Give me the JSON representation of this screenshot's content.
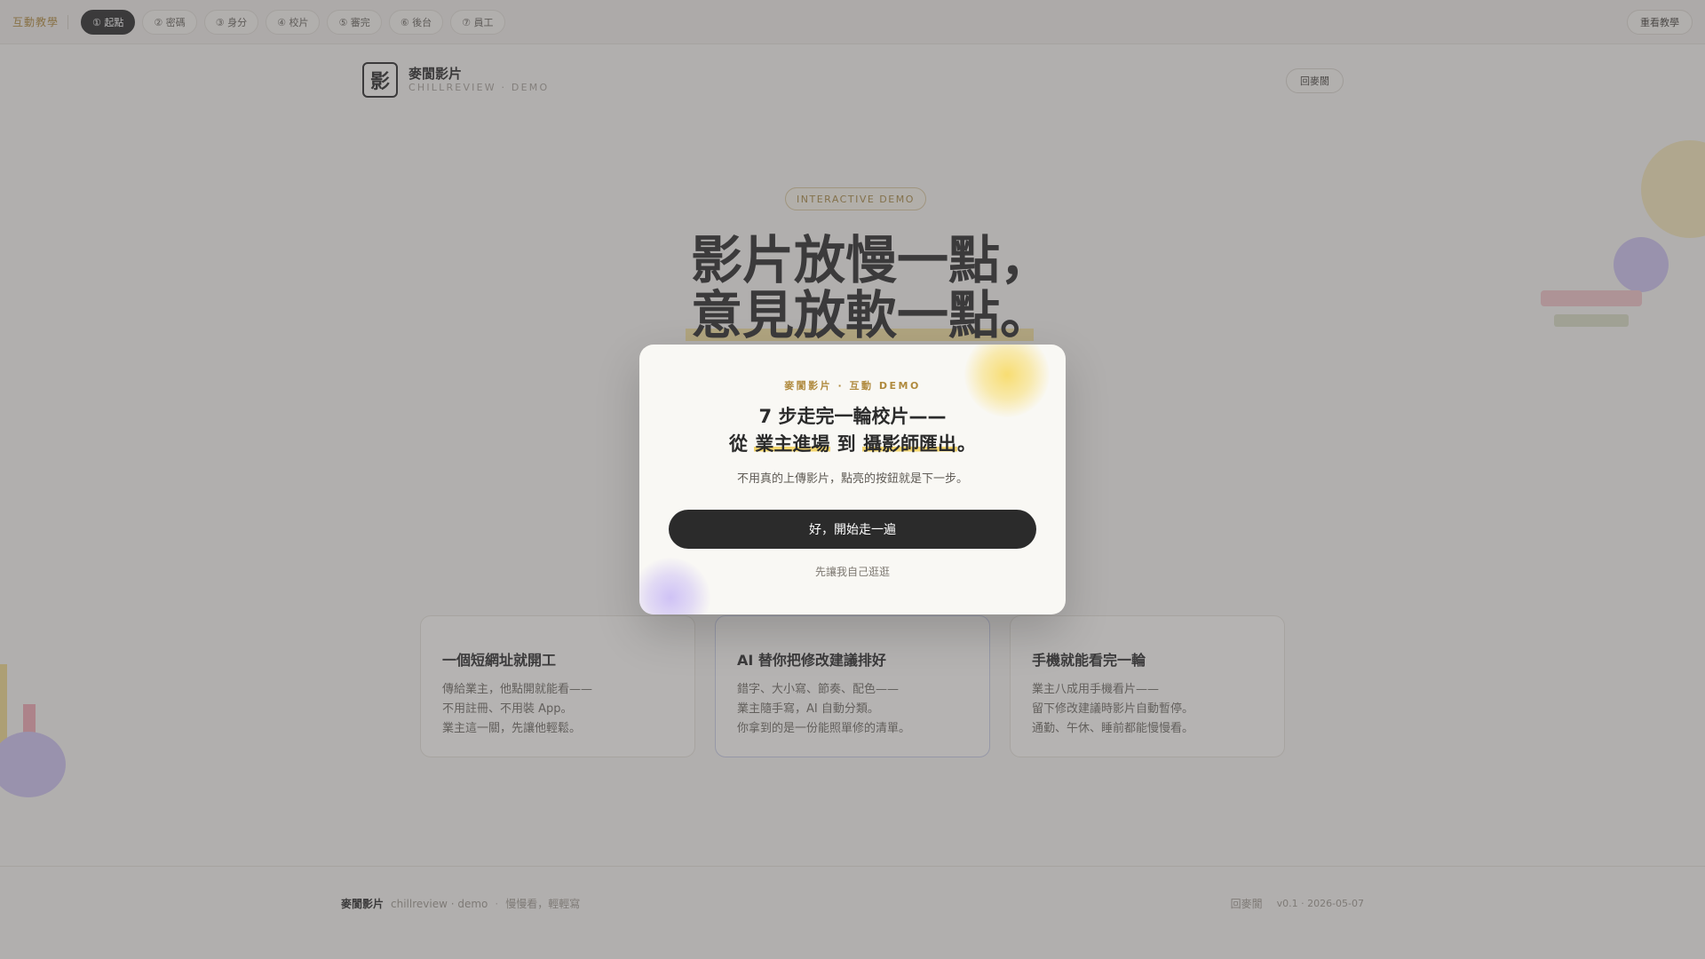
{
  "tutorial_bar": {
    "label": "互動教學",
    "steps": [
      {
        "label": "① 起點",
        "active": true
      },
      {
        "label": "② 密碼",
        "active": false
      },
      {
        "label": "③ 身分",
        "active": false
      },
      {
        "label": "④ 校片",
        "active": false
      },
      {
        "label": "⑤ 審完",
        "active": false
      },
      {
        "label": "⑥ 後台",
        "active": false
      },
      {
        "label": "⑦ 員工",
        "active": false
      }
    ],
    "replay_label": "重看教學"
  },
  "header": {
    "logo_glyph": "影",
    "brand_name": "麥閬影片",
    "brand_sub": "CHILLREVIEW · DEMO",
    "home_button": "回麥閬"
  },
  "hero": {
    "badge": "INTERACTIVE DEMO",
    "title_line1": "影片放慢一點，",
    "title_line2": "意見放軟一點。"
  },
  "cards": [
    {
      "title": "一個短網址就開工",
      "lines": [
        "傳給業主，他點開就能看——",
        "不用註冊、不用裝 App。",
        "業主這一關，先讓他輕鬆。"
      ]
    },
    {
      "title": "AI 替你把修改建議排好",
      "lines": [
        "錯字、大小寫、節奏、配色——",
        "業主隨手寫，AI 自動分類。",
        "你拿到的是一份能照單修的清單。"
      ]
    },
    {
      "title": "手機就能看完一輪",
      "lines": [
        "業主八成用手機看片——",
        "留下修改建議時影片自動暫停。",
        "通勤、午休、睡前都能慢慢看。"
      ]
    }
  ],
  "footer": {
    "brand": "麥閬影片",
    "sub": "chillreview · demo",
    "dot": "·",
    "tagline": "慢慢看，輕輕寫",
    "home_link": "回麥閬",
    "version": "v0.1 · 2026-05-07"
  },
  "modal": {
    "eyebrow": "麥閬影片 · 互動 DEMO",
    "title_line1": "7 步走完一輪校片——",
    "title_prefix": "從",
    "title_hl1": "業主進場",
    "title_mid": "到",
    "title_hl2": "攝影師匯出",
    "title_suffix": "。",
    "description": "不用真的上傳影片，點亮的按鈕就是下一步。",
    "primary_button": "好，開始走一遍",
    "secondary_link": "先讓我自己逛逛"
  },
  "colors": {
    "accent_gold": "#b08a3e",
    "dark": "#2b2b2b",
    "highlight_yellow": "#f5d76e",
    "background": "#f7f5f1"
  }
}
